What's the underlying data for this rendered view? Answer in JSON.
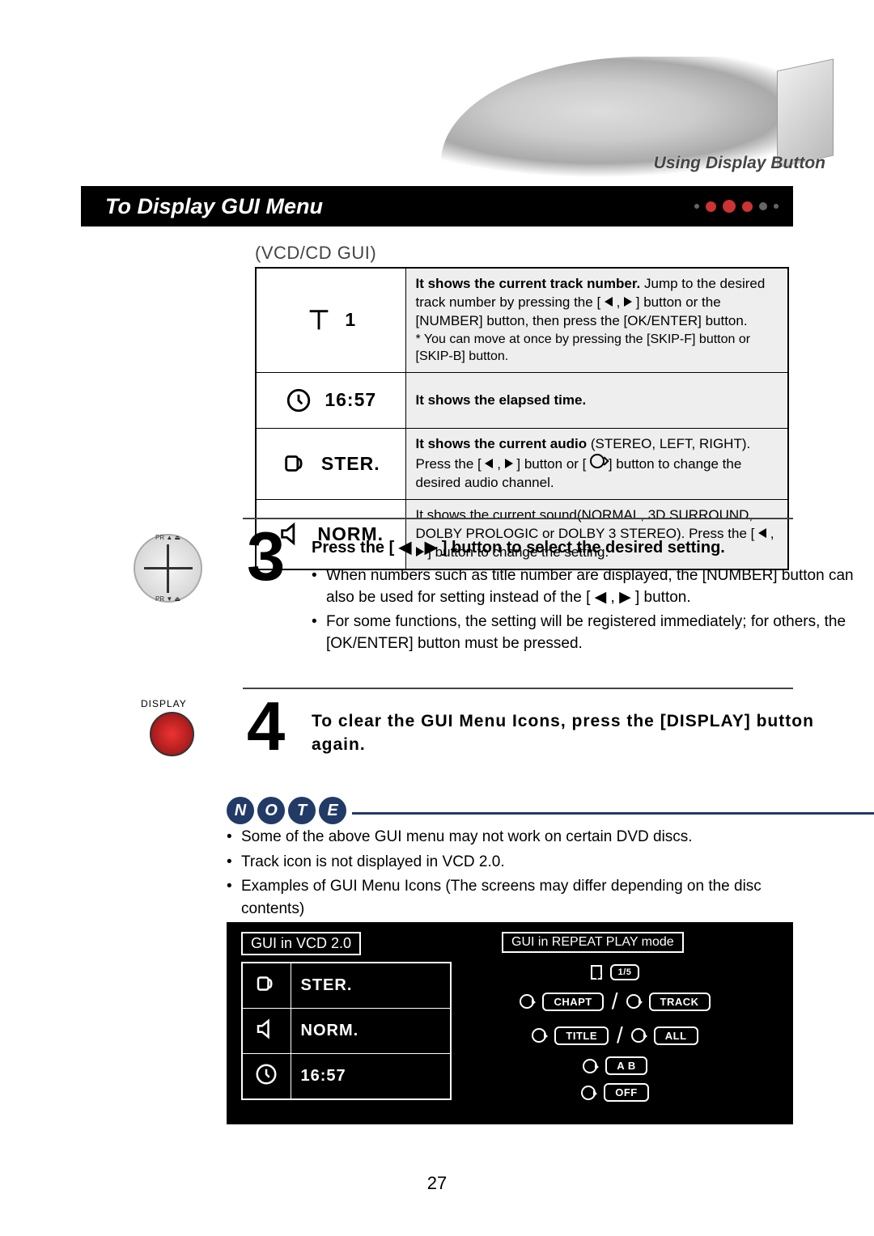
{
  "header": {
    "subtitle": "Using Display Button"
  },
  "title": "To Display GUI Menu",
  "vcd_label": "(VCD/CD GUI)",
  "gui_rows": [
    {
      "value": "1",
      "desc_html": "It shows the current track number. Jump to the desired track number by pressing the [ ◀ , ▶ ] button or the [NUMBER] button, then press the [OK/ENTER] button.",
      "desc_sub": "* You can move at once by pressing the [SKIP-F] button or [SKIP-B] button."
    },
    {
      "value": "16:57",
      "desc_html": "It shows the elapsed time."
    },
    {
      "value": "STER.",
      "desc_html": "It shows the current audio (STEREO, LEFT, RIGHT). Press the [ ◀ , ▶ ] button or [ 🔊 ] button to change the desired audio channel."
    },
    {
      "value": "NORM.",
      "desc_html": "It shows the current sound(NORMAL, 3D SURROUND, DOLBY PROLOGIC or DOLBY 3 STEREO). Press the [ ◀ , ▶ ] button to change the setting."
    }
  ],
  "step3": {
    "heading": "Press the [ ◀ , ▶ ] button to select the desired setting.",
    "bullets": [
      "When numbers such as title number are displayed, the [NUMBER] button can also be used for setting instead of the [ ◀ , ▶ ] button.",
      "For some functions, the setting will be registered immediately; for others, the [OK/ENTER] button must be pressed."
    ]
  },
  "step4": {
    "button_label": "DISPLAY",
    "heading": "To clear the GUI Menu Icons, press the [DISPLAY] button again."
  },
  "note": {
    "letters": [
      "N",
      "O",
      "T",
      "E"
    ],
    "bullets": [
      "Some of the above GUI menu may not work on certain DVD discs.",
      "Track icon is not displayed in VCD 2.0.",
      "Examples of  GUI Menu  Icons (The screens may differ depending on the disc contents)"
    ]
  },
  "box": {
    "col1": {
      "label": "GUI in VCD 2.0",
      "rows": [
        {
          "value": "STER."
        },
        {
          "value": "NORM."
        },
        {
          "value": "16:57"
        }
      ]
    },
    "col2": {
      "label": "GUI in REPEAT PLAY mode",
      "bookmark": "1/5",
      "pairs": [
        [
          "CHAPT",
          "TRACK"
        ],
        [
          "TITLE",
          "ALL"
        ]
      ],
      "singles": [
        "A  B",
        "OFF"
      ]
    }
  },
  "page_number": "27"
}
